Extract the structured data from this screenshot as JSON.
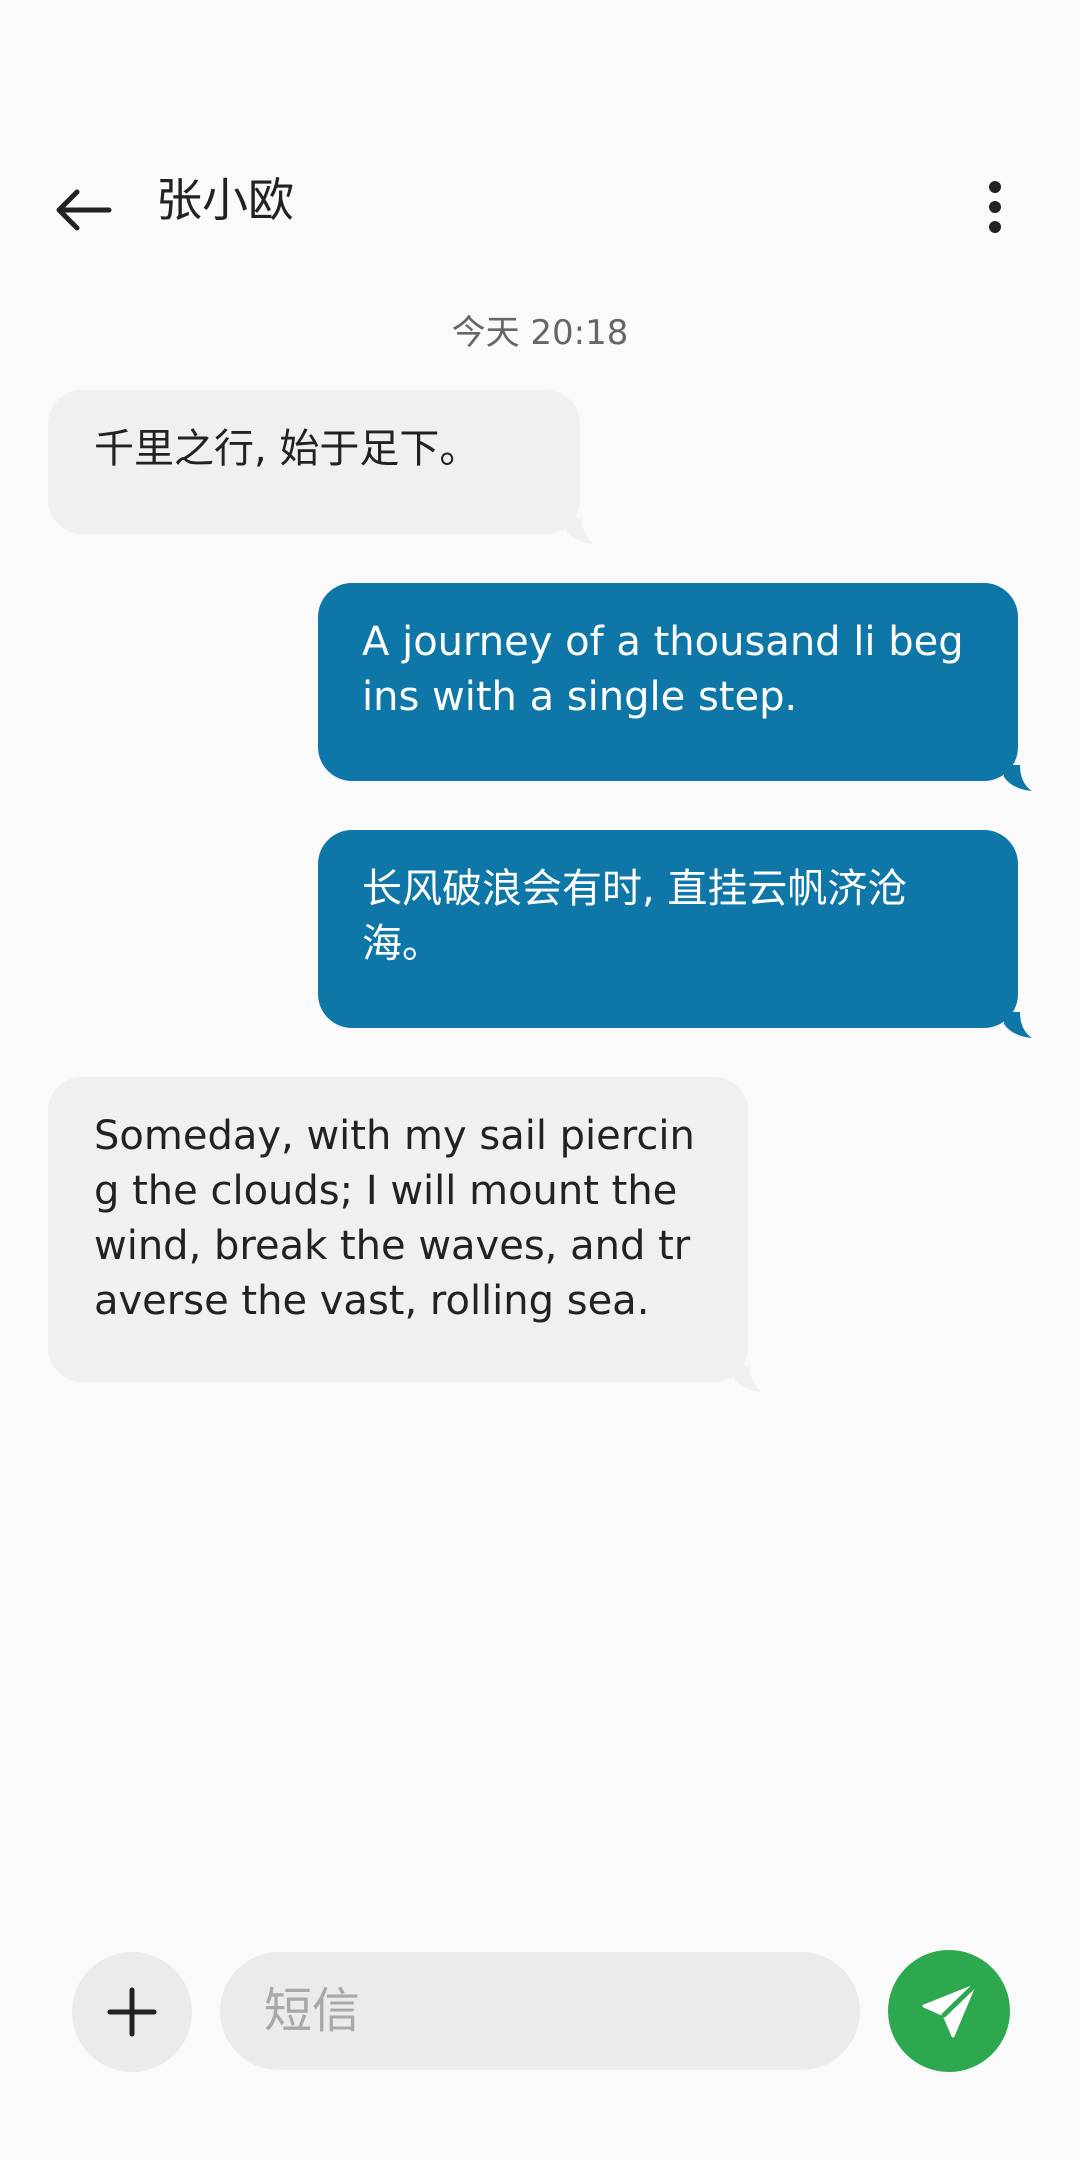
{
  "header": {
    "contact_name": "张小欧",
    "back_icon": "arrow-left-icon",
    "more_icon": "more-vertical-icon"
  },
  "conversation": {
    "timestamp": "今天 20:18",
    "messages": [
      {
        "direction": "incoming",
        "text": "千里之行, 始于足下。"
      },
      {
        "direction": "outgoing",
        "text": "A journey of a thousand li begins with a single step."
      },
      {
        "direction": "outgoing",
        "text": "长风破浪会有时, 直挂云帆济沧海。"
      },
      {
        "direction": "incoming",
        "text": "Someday, with my sail piercing the clouds; I will mount the wind, break the waves, and traverse the vast, rolling sea."
      }
    ]
  },
  "composer": {
    "placeholder": "短信",
    "value": "",
    "add_icon": "plus-icon",
    "send_icon": "send-icon"
  },
  "colors": {
    "background": "#fafafa",
    "incoming_bubble": "#f0f0f0",
    "outgoing_bubble": "#0f77a8",
    "send_button": "#2ea84f",
    "control_gray": "#ebebeb"
  }
}
